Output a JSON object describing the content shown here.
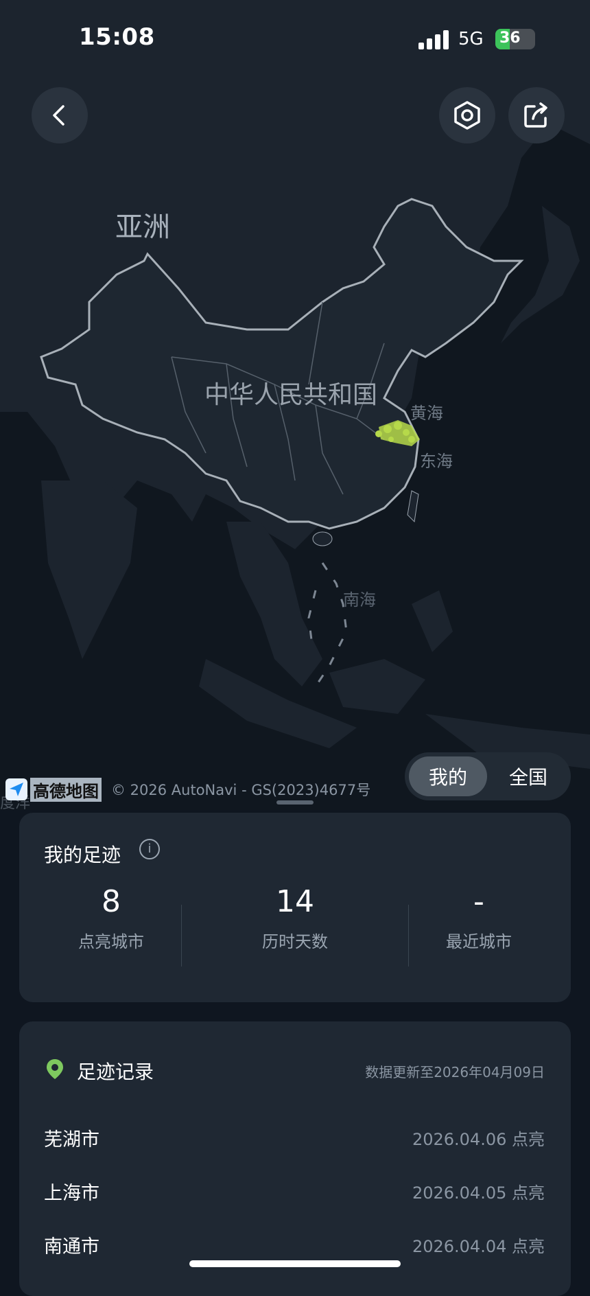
{
  "status_bar": {
    "time": "15:08",
    "network": "5G",
    "battery": "36",
    "battery_level": 0.36
  },
  "map": {
    "label_asia": "亚洲",
    "label_china": "中华人民共和国",
    "label_yellow_sea": "黄海",
    "label_east_sea": "东海",
    "label_south_sea": "南海",
    "label_edge": "度洋",
    "attribution_brand": "高德地图",
    "attribution_text": "© 2026 AutoNavi - GS(2023)4677号"
  },
  "buttons": {
    "back_icon": "chevron-left-icon",
    "settings_icon": "hexagon-settings-icon",
    "share_icon": "share-icon"
  },
  "scope_toggle": {
    "mine": "我的",
    "national": "全国",
    "selected": "我的"
  },
  "footprint_summary": {
    "title": "我的足迹",
    "stats": [
      {
        "value": "8",
        "label": "点亮城市"
      },
      {
        "value": "14",
        "label": "历时天数"
      },
      {
        "value": "-",
        "label": "最近城市"
      }
    ]
  },
  "footprint_records": {
    "title": "足迹记录",
    "updated": "数据更新至2026年04月09日",
    "items": [
      {
        "city": "芜湖市",
        "date": "2026.04.06 点亮"
      },
      {
        "city": "上海市",
        "date": "2026.04.05 点亮"
      },
      {
        "city": "南通市",
        "date": "2026.04.04 点亮"
      }
    ]
  },
  "colors": {
    "background": "#0f1620",
    "card": "#1f2833",
    "highlight": "#b6d94a",
    "pin": "#7ec95f"
  }
}
